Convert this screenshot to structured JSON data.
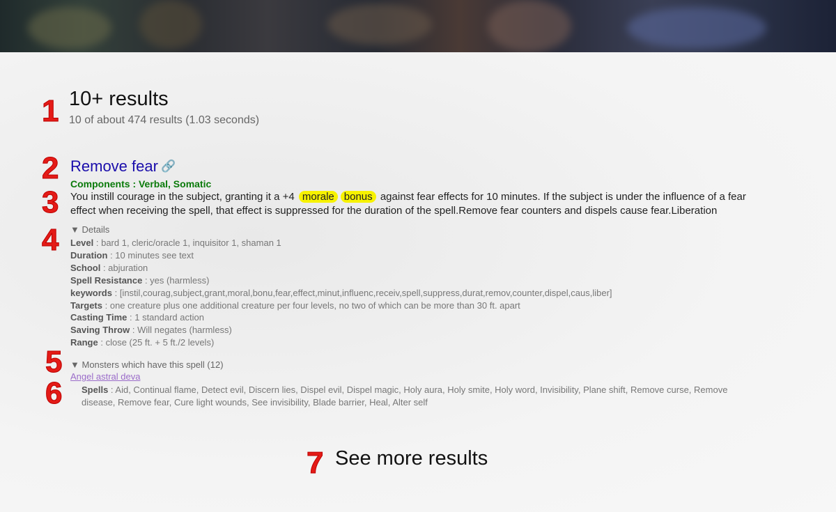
{
  "results": {
    "title": "10+ results",
    "subtitle": "10 of about 474 results (1.03 seconds)"
  },
  "markers": [
    "1",
    "2",
    "3",
    "4",
    "5",
    "6",
    "7"
  ],
  "spell": {
    "title": "Remove fear",
    "link_icon": "🔗",
    "components": "Components : Verbal, Somatic",
    "description_before": "You instill courage in the subject, granting it a +4",
    "highlight_1": "morale",
    "highlight_2": "bonus",
    "description_after": "against fear effects for 10 minutes. If the subject is under the influence of a fear effect when receiving the spell, that effect is suppressed for the duration of the spell.Remove fear counters and dispels cause fear.Liberation",
    "details_label": "Details",
    "details": [
      {
        "key": "Level",
        "value": " : bard 1, cleric/oracle 1, inquisitor 1, shaman 1"
      },
      {
        "key": "Duration",
        "value": " : 10 minutes see text"
      },
      {
        "key": "School",
        "value": " : abjuration"
      },
      {
        "key": "Spell Resistance",
        "value": " : yes (harmless)"
      },
      {
        "key": "keywords",
        "value": " : [instil,courag,subject,grant,moral,bonu,fear,effect,minut,influenc,receiv,spell,suppress,durat,remov,counter,dispel,caus,liber]"
      },
      {
        "key": "Targets",
        "value": " : one creature plus one additional creature per four levels, no two of which can be more than 30 ft. apart"
      },
      {
        "key": "Casting Time",
        "value": " : 1 standard action"
      },
      {
        "key": "Saving Throw",
        "value": " : Will negates (harmless)"
      },
      {
        "key": "Range",
        "value": " : close (25 ft. + 5 ft./2 levels)"
      }
    ],
    "monsters_label": "Monsters which have this spell (12)",
    "monster_name": "Angel astral deva",
    "monster_spells_key": "Spells",
    "monster_spells_value": " : Aid, Continual flame, Detect evil, Discern lies, Dispel evil, Dispel magic, Holy aura, Holy smite, Holy word, Invisibility, Plane shift, Remove curse, Remove disease, Remove fear, Cure light wounds, See invisibility, Blade barrier, Heal, Alter self"
  },
  "see_more": "See more results",
  "colors": {
    "title_link": "#1a0dab",
    "components": "#0a7a0a",
    "highlight": "#f7f200",
    "marker": "#e41b17",
    "visited_link": "#9a6bc9"
  }
}
